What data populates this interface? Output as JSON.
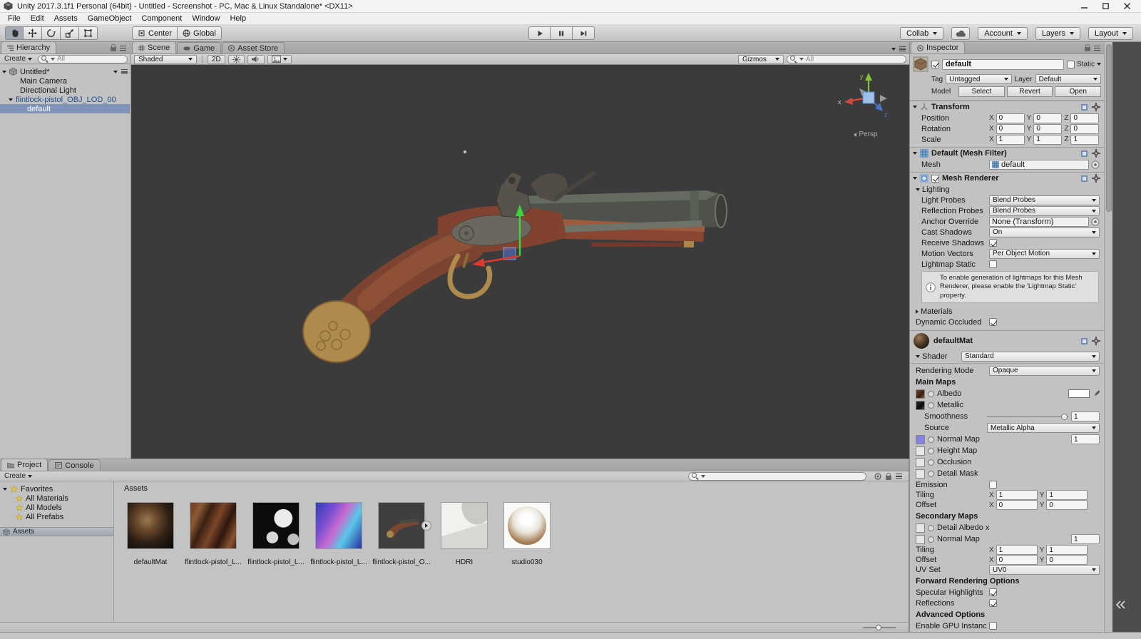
{
  "window": {
    "title": "Unity 2017.3.1f1 Personal (64bit) - Untitled - Screenshot - PC, Mac & Linux Standalone* <DX11>"
  },
  "menubar": {
    "items": [
      "File",
      "Edit",
      "Assets",
      "GameObject",
      "Component",
      "Window",
      "Help"
    ]
  },
  "toolbar": {
    "pivot": "Center",
    "orientation": "Global",
    "collab": "Collab",
    "account": "Account",
    "layers": "Layers",
    "layout": "Layout"
  },
  "hierarchy": {
    "tab": "Hierarchy",
    "create": "Create",
    "search": "All",
    "scene_name": "Untitled*",
    "items": [
      {
        "label": "Main Camera"
      },
      {
        "label": "Directional Light"
      },
      {
        "label": "flintlock-pistol_OBJ_LOD_00"
      },
      {
        "label": "default"
      }
    ]
  },
  "scene": {
    "tabs": [
      {
        "label": "Scene"
      },
      {
        "label": "Game"
      },
      {
        "label": "Asset Store"
      }
    ],
    "shading": "Shaded",
    "mode2d": "2D",
    "gizmos": "Gizmos",
    "search": "All",
    "axis": {
      "x": "x",
      "y": "y",
      "z": "z"
    },
    "projection": "Persp"
  },
  "project": {
    "tabs": [
      {
        "label": "Project"
      },
      {
        "label": "Console"
      }
    ],
    "create": "Create",
    "search": "",
    "favorites": "Favorites",
    "favorite_items": [
      {
        "label": "All Materials"
      },
      {
        "label": "All Models"
      },
      {
        "label": "All Prefabs"
      }
    ],
    "assets_folder": "Assets",
    "header": "Assets",
    "items": [
      {
        "name": "defaultMat"
      },
      {
        "name": "flintlock-pistol_L..."
      },
      {
        "name": "flintlock-pistol_L..."
      },
      {
        "name": "flintlock-pistol_L..."
      },
      {
        "name": "flintlock-pistol_O..."
      },
      {
        "name": "HDRI"
      },
      {
        "name": "studio030"
      }
    ]
  },
  "inspector": {
    "tab": "Inspector",
    "name": "default",
    "static": "Static",
    "tag_label": "Tag",
    "tag": "Untagged",
    "layer_label": "Layer",
    "layer": "Default",
    "model_label": "Model",
    "model_buttons": [
      {
        "label": "Select"
      },
      {
        "label": "Revert"
      },
      {
        "label": "Open"
      }
    ],
    "axes": {
      "x": "X",
      "y": "Y",
      "z": "Z"
    },
    "transform": {
      "title": "Transform",
      "rows": [
        {
          "label": "Position",
          "x": "0",
          "y": "0",
          "z": "0"
        },
        {
          "label": "Rotation",
          "x": "0",
          "y": "0",
          "z": "0"
        },
        {
          "label": "Scale",
          "x": "1",
          "y": "1",
          "z": "1"
        }
      ]
    },
    "mesh_filter": {
      "title": "Default (Mesh Filter)",
      "mesh_label": "Mesh",
      "mesh": "default"
    },
    "renderer": {
      "title": "Mesh Renderer",
      "lighting": "Lighting",
      "light_probes_label": "Light Probes",
      "light_probes": "Blend Probes",
      "reflection_probes_label": "Reflection Probes",
      "reflection_probes": "Blend Probes",
      "anchor_label": "Anchor Override",
      "anchor": "None (Transform)",
      "cast_shadows_label": "Cast Shadows",
      "cast_shadows": "On",
      "receive_shadows": "Receive Shadows",
      "motion_vectors_label": "Motion Vectors",
      "motion_vectors": "Per Object Motion",
      "lightmap_static": "Lightmap Static",
      "info": "To enable generation of lightmaps for this Mesh Renderer, please enable the 'Lightmap Static' property.",
      "materials": "Materials",
      "dynamic_occluded": "Dynamic Occluded"
    },
    "material": {
      "name": "defaultMat",
      "shader_label": "Shader",
      "shader": "Standard",
      "rendering_mode_label": "Rendering Mode",
      "rendering_mode": "Opaque",
      "main_maps": "Main Maps",
      "albedo": "Albedo",
      "metallic": "Metallic",
      "smoothness": "Smoothness",
      "smoothness_value": "1",
      "source_label": "Source",
      "source": "Metallic Alpha",
      "normal_map": "Normal Map",
      "normal_scale": "1",
      "height_map": "Height Map",
      "occlusion": "Occlusion",
      "detail_mask": "Detail Mask",
      "emission": "Emission",
      "tiling": "Tiling",
      "offset": "Offset",
      "main_tiling": {
        "x": "1",
        "y": "1"
      },
      "main_offset": {
        "x": "0",
        "y": "0"
      },
      "secondary_maps": "Secondary Maps",
      "detail_albedo": "Detail Albedo x",
      "secondary_normal": "Normal Map",
      "secondary_normal_scale": "1",
      "secondary_tiling": {
        "x": "1",
        "y": "1"
      },
      "secondary_offset": {
        "x": "0",
        "y": "0"
      },
      "uv_set_label": "UV Set",
      "uv_set": "UV0",
      "forward_options": "Forward Rendering Options",
      "specular_highlights": "Specular Highlights",
      "reflections": "Reflections",
      "advanced_options": "Advanced Options",
      "gpu_instancing": "Enable GPU Instanci"
    }
  }
}
